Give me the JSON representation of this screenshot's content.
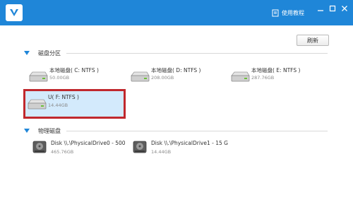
{
  "titlebar": {
    "logo_icon": "app-logo-v-icon",
    "tutorial_label": "使用教程",
    "tutorial_icon": "book-icon",
    "controls": [
      "minimize-icon",
      "maximize-icon",
      "close-icon"
    ],
    "color": "#1f86d8"
  },
  "toolbar": {
    "refresh_label": "刷新"
  },
  "partitions": {
    "title": "磁盘分区",
    "items": [
      {
        "name": "本地磁盘( C: NTFS )",
        "size": "50.00GB",
        "icon": "hard-drive-icon"
      },
      {
        "name": "本地磁盘( D: NTFS )",
        "size": "208.00GB",
        "icon": "hard-drive-icon"
      },
      {
        "name": "本地磁盘( E: NTFS )",
        "size": "287.76GB",
        "icon": "hard-drive-icon"
      },
      {
        "name": "U( F: NTFS )",
        "size": "14.44GB",
        "icon": "hard-drive-icon",
        "selected": true
      }
    ]
  },
  "physical": {
    "title": "物理磁盘",
    "items": [
      {
        "name": "Disk \\\\.\\PhysicalDrive0 - 500",
        "size": "465.76GB",
        "icon": "physical-disk-icon"
      },
      {
        "name": "Disk \\\\.\\PhysicalDrive1 - 15 G",
        "size": "14.44GB",
        "icon": "physical-disk-icon"
      }
    ]
  },
  "colors": {
    "accent": "#1f86d8",
    "selection_border": "#c0282d",
    "selection_fill": "#d3eafc"
  }
}
